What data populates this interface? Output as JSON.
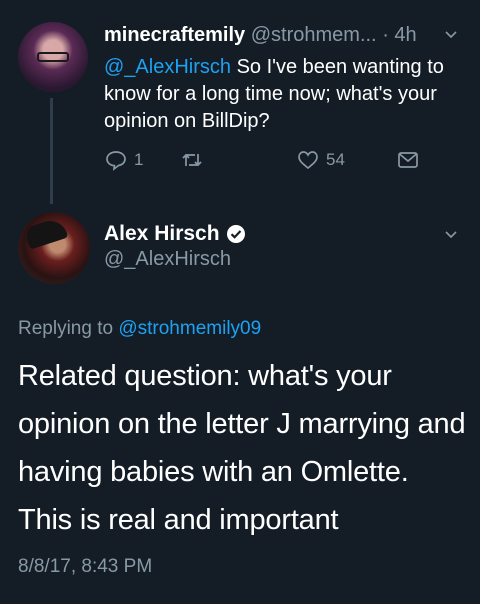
{
  "reply_tweet": {
    "display_name": "minecraftemily",
    "handle": "@strohmem...",
    "time": "· 4h",
    "mention": "@_AlexHirsch",
    "text": " So I've been wanting to know for a long time now; what's your opinion on BillDip?",
    "reply_count": "1",
    "retweet_count": "",
    "like_count": "54"
  },
  "main_tweet": {
    "display_name": "Alex Hirsch",
    "handle": "@_AlexHirsch",
    "replying_prefix": "Replying to ",
    "replying_handle": "@strohmemily09",
    "text": "Related question: what's your opinion on the letter J marrying and having babies with an Omlette. This is real and important",
    "timestamp": "8/8/17, 8:43 PM"
  },
  "colors": {
    "background": "#141d26",
    "accent": "#1da1f2",
    "muted": "#8899a6"
  },
  "icons": [
    "reply-icon",
    "retweet-icon",
    "like-icon",
    "message-icon",
    "chevron-down-icon",
    "verified-icon"
  ]
}
